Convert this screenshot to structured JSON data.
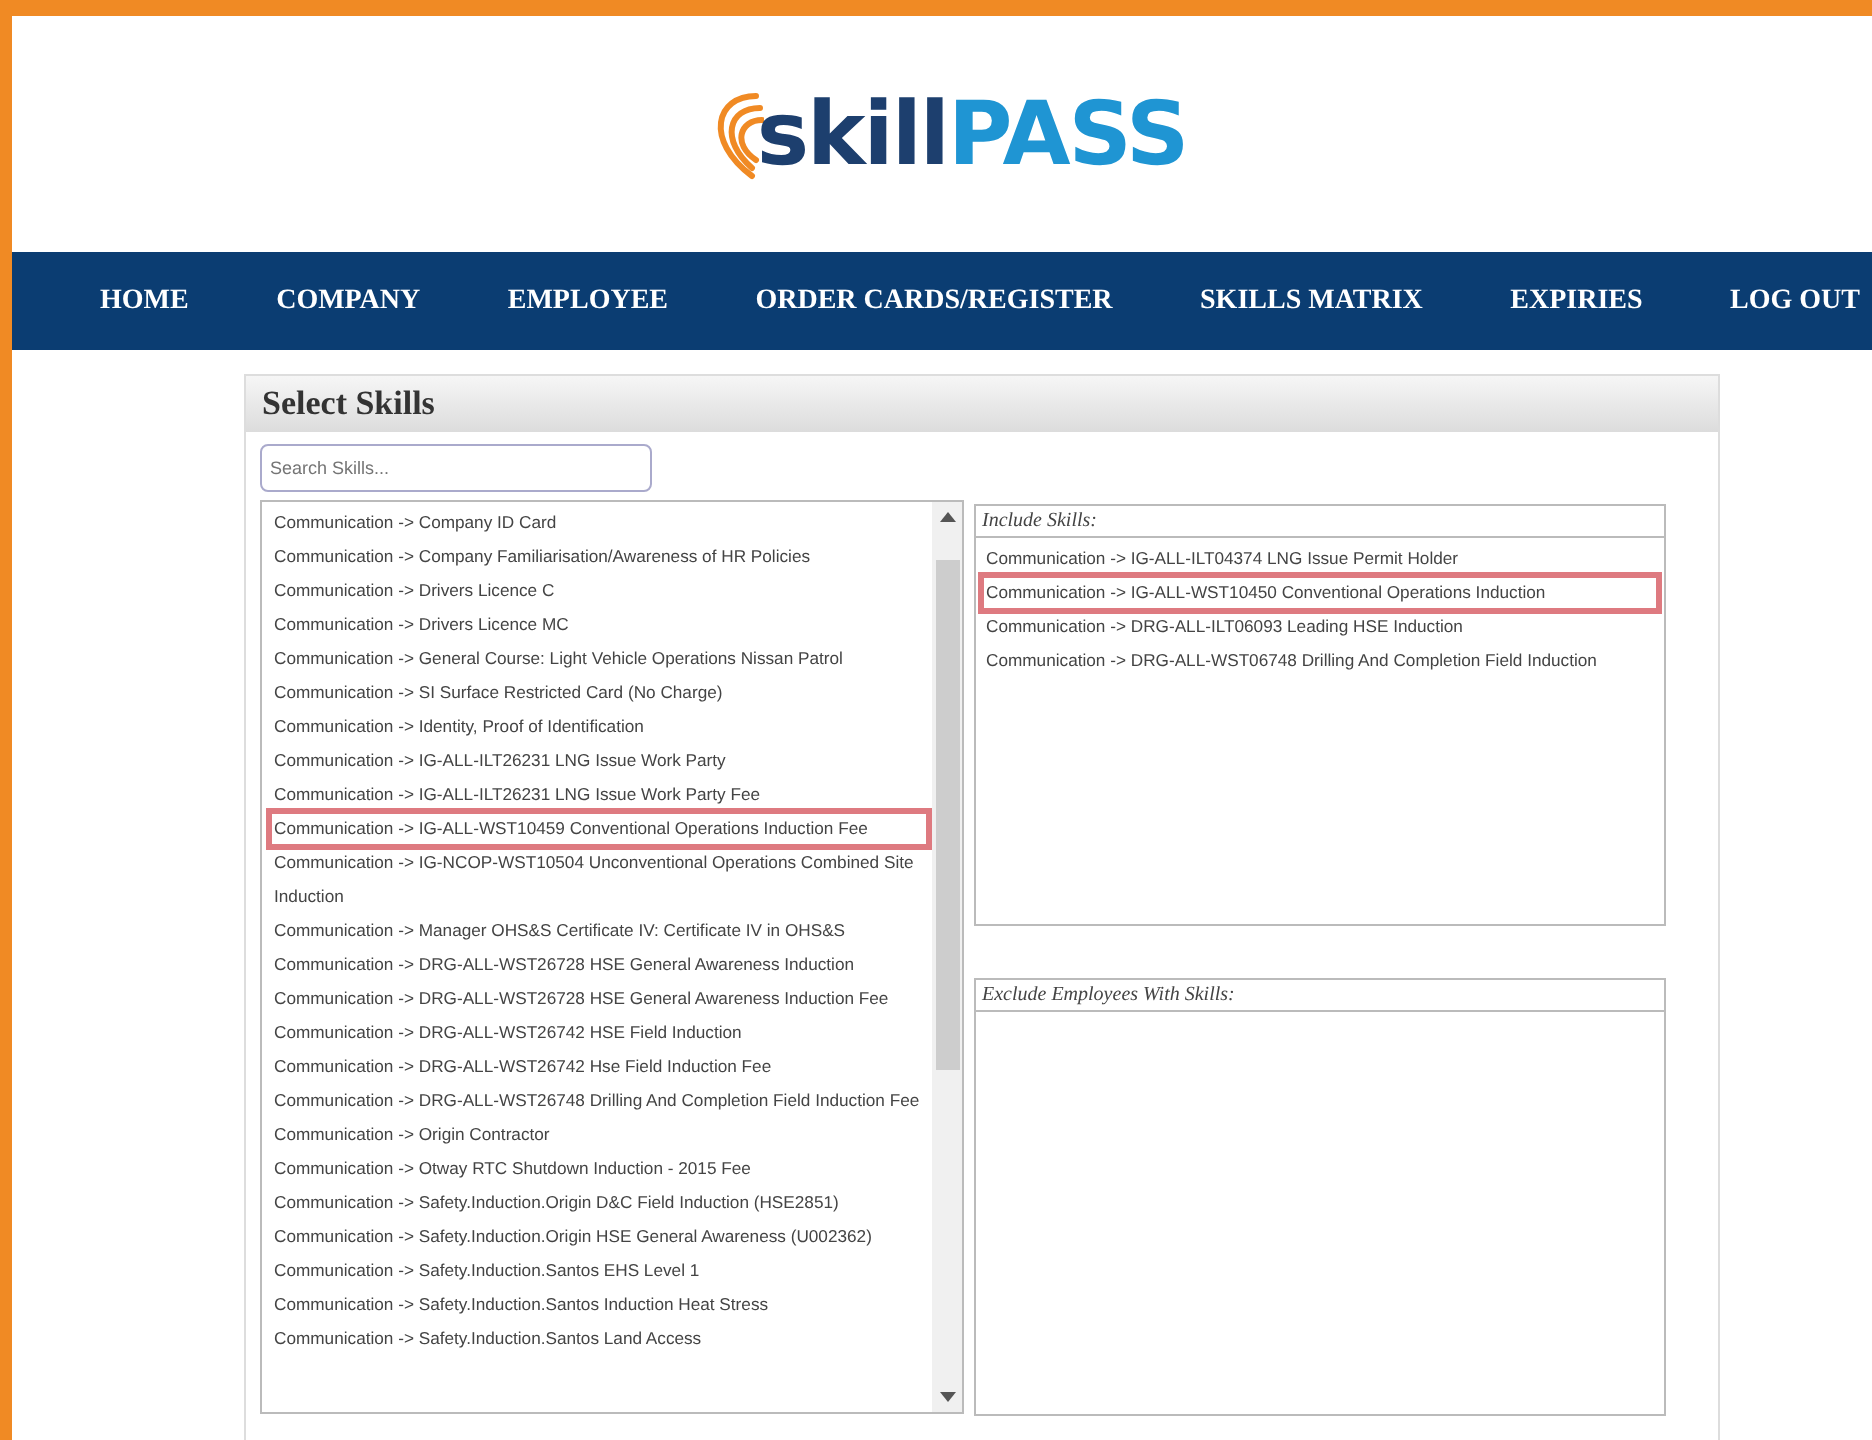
{
  "logo": {
    "part_1": "skill",
    "part_2": "PASS"
  },
  "nav": [
    {
      "label": "HOME"
    },
    {
      "label": "COMPANY"
    },
    {
      "label": "EMPLOYEE"
    },
    {
      "label": "ORDER CARDS/REGISTER"
    },
    {
      "label": "SKILLS MATRIX"
    },
    {
      "label": "EXPIRIES"
    },
    {
      "label": "LOG OUT"
    }
  ],
  "panel": {
    "title": "Select Skills",
    "search": {
      "placeholder": "Search Skills..."
    },
    "skills": [
      {
        "label": "Communication -> Company ID Card",
        "highlighted": false
      },
      {
        "label": "Communication -> Company Familiarisation/Awareness of HR Policies",
        "highlighted": false
      },
      {
        "label": "Communication -> Drivers Licence C",
        "highlighted": false
      },
      {
        "label": "Communication -> Drivers Licence MC",
        "highlighted": false
      },
      {
        "label": "Communication -> General Course: Light Vehicle Operations Nissan Patrol",
        "highlighted": false
      },
      {
        "label": "Communication -> SI Surface Restricted Card (No Charge)",
        "highlighted": false
      },
      {
        "label": "Communication -> Identity, Proof of Identification",
        "highlighted": false
      },
      {
        "label": "Communication -> IG-ALL-ILT26231 LNG Issue Work Party",
        "highlighted": false
      },
      {
        "label": "Communication -> IG-ALL-ILT26231 LNG Issue Work Party Fee",
        "highlighted": false
      },
      {
        "label": "Communication -> IG-ALL-WST10459 Conventional Operations Induction Fee",
        "highlighted": true
      },
      {
        "label": "Communication -> IG-NCOP-WST10504 Unconventional Operations Combined Site Induction",
        "highlighted": false
      },
      {
        "label": "Communication -> Manager OHS&S Certificate IV: Certificate IV in OHS&S",
        "highlighted": false
      },
      {
        "label": "Communication -> DRG-ALL-WST26728 HSE General Awareness Induction",
        "highlighted": false
      },
      {
        "label": "Communication -> DRG-ALL-WST26728 HSE General Awareness Induction Fee",
        "highlighted": false
      },
      {
        "label": "Communication -> DRG-ALL-WST26742 HSE Field Induction",
        "highlighted": false
      },
      {
        "label": "Communication -> DRG-ALL-WST26742 Hse Field Induction Fee",
        "highlighted": false
      },
      {
        "label": "Communication -> DRG-ALL-WST26748 Drilling And Completion Field Induction Fee",
        "highlighted": false
      },
      {
        "label": "Communication -> Origin Contractor",
        "highlighted": false
      },
      {
        "label": "Communication -> Otway RTC Shutdown Induction - 2015 Fee",
        "highlighted": false
      },
      {
        "label": "Communication -> Safety.Induction.Origin D&C Field Induction (HSE2851)",
        "highlighted": false
      },
      {
        "label": "Communication -> Safety.Induction.Origin HSE General Awareness (U002362)",
        "highlighted": false
      },
      {
        "label": "Communication -> Safety.Induction.Santos EHS Level 1",
        "highlighted": false
      },
      {
        "label": "Communication -> Safety.Induction.Santos Induction Heat Stress",
        "highlighted": false
      },
      {
        "label": "Communication -> Safety.Induction.Santos Land Access",
        "highlighted": false
      }
    ],
    "include": {
      "title": "Include Skills:",
      "items": [
        {
          "label": "Communication -> IG-ALL-ILT04374 LNG Issue Permit Holder",
          "highlighted": false
        },
        {
          "label": "Communication -> IG-ALL-WST10450 Conventional Operations Induction",
          "highlighted": true
        },
        {
          "label": "Communication -> DRG-ALL-ILT06093 Leading HSE Induction",
          "highlighted": false
        },
        {
          "label": "Communication -> DRG-ALL-WST06748 Drilling And Completion Field Induction",
          "highlighted": false
        }
      ]
    },
    "exclude": {
      "title": "Exclude Employees With Skills:"
    }
  }
}
